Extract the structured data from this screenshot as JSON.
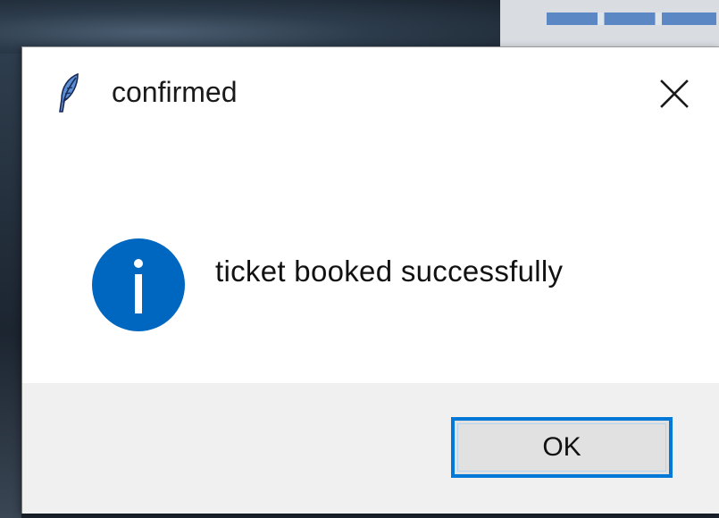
{
  "dialog": {
    "title": "confirmed",
    "app_icon": "feather-icon",
    "close_icon": "close-icon",
    "message_icon": "info-icon",
    "message": "ticket booked successfully",
    "ok_label": "OK"
  },
  "colors": {
    "accent": "#0078d7",
    "info_circle": "#0067c0",
    "footer_bg": "#f0f0f0",
    "button_bg": "#e1e1e1"
  }
}
